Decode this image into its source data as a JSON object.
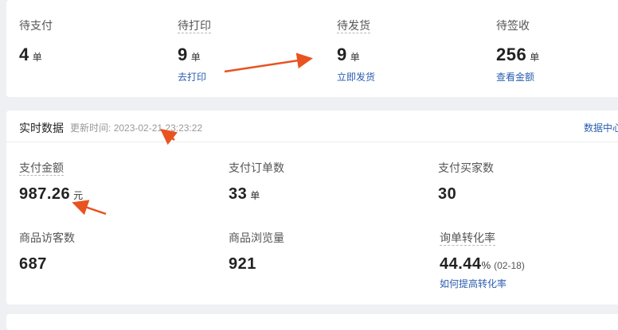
{
  "orders": [
    {
      "label": "待支付",
      "value": "4",
      "unit": "单",
      "link": ""
    },
    {
      "label": "待打印",
      "value": "9",
      "unit": "单",
      "link": "去打印"
    },
    {
      "label": "待发货",
      "value": "9",
      "unit": "单",
      "link": "立即发货"
    },
    {
      "label": "待签收",
      "value": "256",
      "unit": "单",
      "link": "查看金额"
    }
  ],
  "realtime": {
    "title": "实时数据",
    "update_label": "更新时间:",
    "update_time": "2023-02-21 23:23:22",
    "data_center_link": "数据中心",
    "stats": [
      {
        "label": "支付金额",
        "value": "987.26",
        "unit": "元"
      },
      {
        "label": "支付订单数",
        "value": "33",
        "unit": "单"
      },
      {
        "label": "支付买家数",
        "value": "30",
        "unit": ""
      },
      {
        "label": "商品访客数",
        "value": "687",
        "unit": ""
      },
      {
        "label": "商品浏览量",
        "value": "921",
        "unit": ""
      },
      {
        "label": "询单转化率",
        "value": "44.44",
        "unit": "%",
        "note": "(02-18)",
        "link": "如何提高转化率"
      }
    ]
  },
  "colors": {
    "accent": "#2a5db0",
    "annotation_arrow": "#e8531f"
  }
}
